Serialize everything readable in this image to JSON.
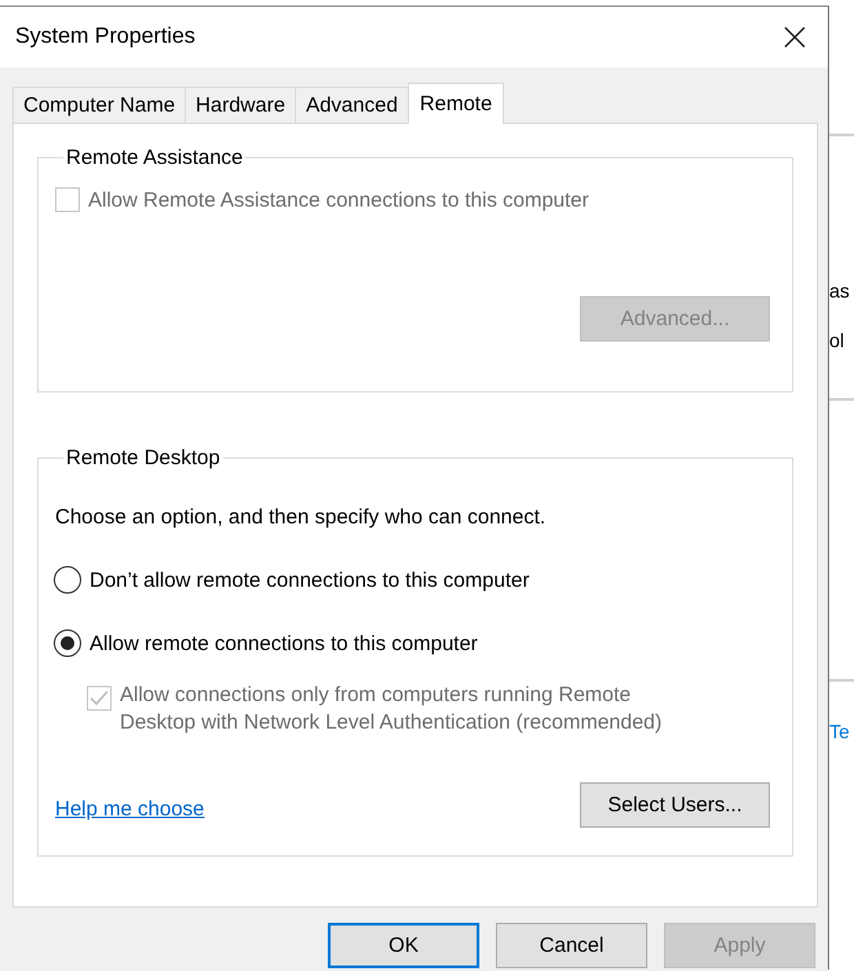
{
  "window": {
    "title": "System Properties"
  },
  "tabs": [
    {
      "label": "Computer Name",
      "selected": false
    },
    {
      "label": "Hardware",
      "selected": false
    },
    {
      "label": "Advanced",
      "selected": false
    },
    {
      "label": "Remote",
      "selected": true
    }
  ],
  "remote_assistance": {
    "title": "Remote Assistance",
    "checkbox": {
      "label": "Allow Remote Assistance connections to this computer",
      "checked": false,
      "disabled": true
    },
    "advanced_button": {
      "label": "Advanced...",
      "disabled": true
    }
  },
  "remote_desktop": {
    "title": "Remote Desktop",
    "instruction": "Choose an option, and then specify who can connect.",
    "options": [
      {
        "label": "Don’t allow remote connections to this computer",
        "selected": false
      },
      {
        "label": "Allow remote connections to this computer",
        "selected": true
      }
    ],
    "nla_checkbox": {
      "label": "Allow connections only from computers running Remote Desktop with Network Level Authentication (recommended)",
      "checked": true,
      "disabled": true
    },
    "help_link": "Help me choose",
    "select_users_button": {
      "label": "Select Users...",
      "disabled": false
    }
  },
  "buttons": [
    {
      "label": "OK",
      "default": true,
      "disabled": false
    },
    {
      "label": "Cancel",
      "default": false,
      "disabled": false
    },
    {
      "label": "Apply",
      "default": false,
      "disabled": true
    }
  ],
  "background_window": {
    "fragments": [
      {
        "text": "as",
        "kind": "text"
      },
      {
        "text": "ol",
        "kind": "text"
      },
      {
        "text": "Te",
        "kind": "link"
      }
    ]
  }
}
